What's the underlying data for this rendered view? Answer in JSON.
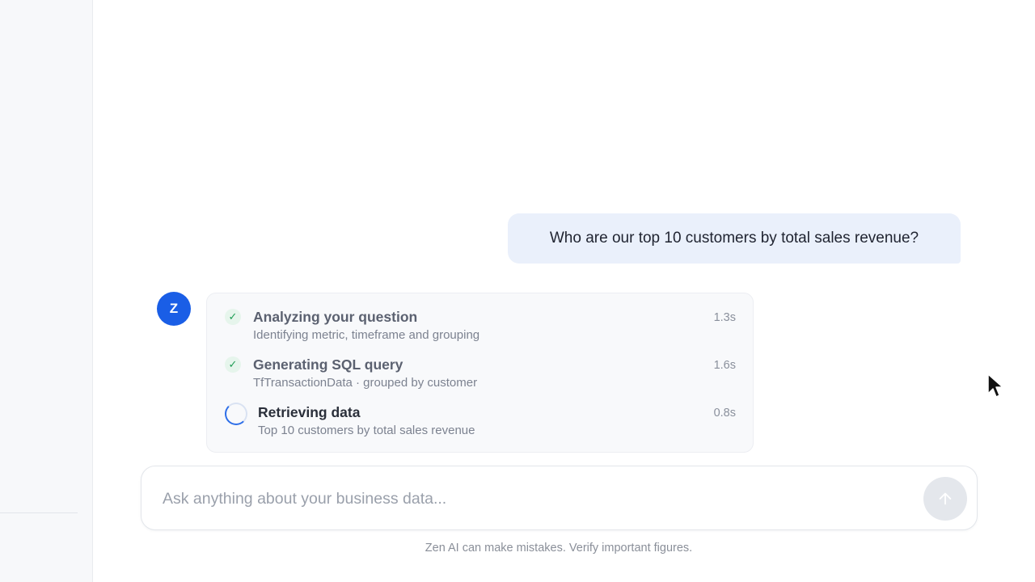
{
  "chat": {
    "user_message": "Who are our top 10 customers by total sales revenue?"
  },
  "assistant": {
    "avatar_letter": "Z",
    "steps": [
      {
        "title": "Analyzing your question",
        "description": "Identifying metric, timeframe and grouping",
        "time": "1.3s",
        "status": "complete",
        "icon": "check-icon"
      },
      {
        "title": "Generating SQL query",
        "description": "TfTransactionData · grouped by customer",
        "time": "1.6s",
        "status": "complete",
        "icon": "check-icon"
      },
      {
        "title": "Retrieving data",
        "description": "Top 10 customers by total sales revenue",
        "time": "0.8s",
        "status": "in-progress",
        "icon": "spinner-icon"
      }
    ]
  },
  "composer": {
    "placeholder": "Ask anything about your business data...",
    "value": "",
    "send_icon": "arrow-up-icon"
  },
  "footer": {
    "disclaimer": "Zen AI can make mistakes. Verify important figures."
  },
  "colors": {
    "accent": "#1a5ee6",
    "user_bubble": "#eaf0fb",
    "success": "#1f9d55",
    "send_button_disabled": "#e4e7ec"
  }
}
